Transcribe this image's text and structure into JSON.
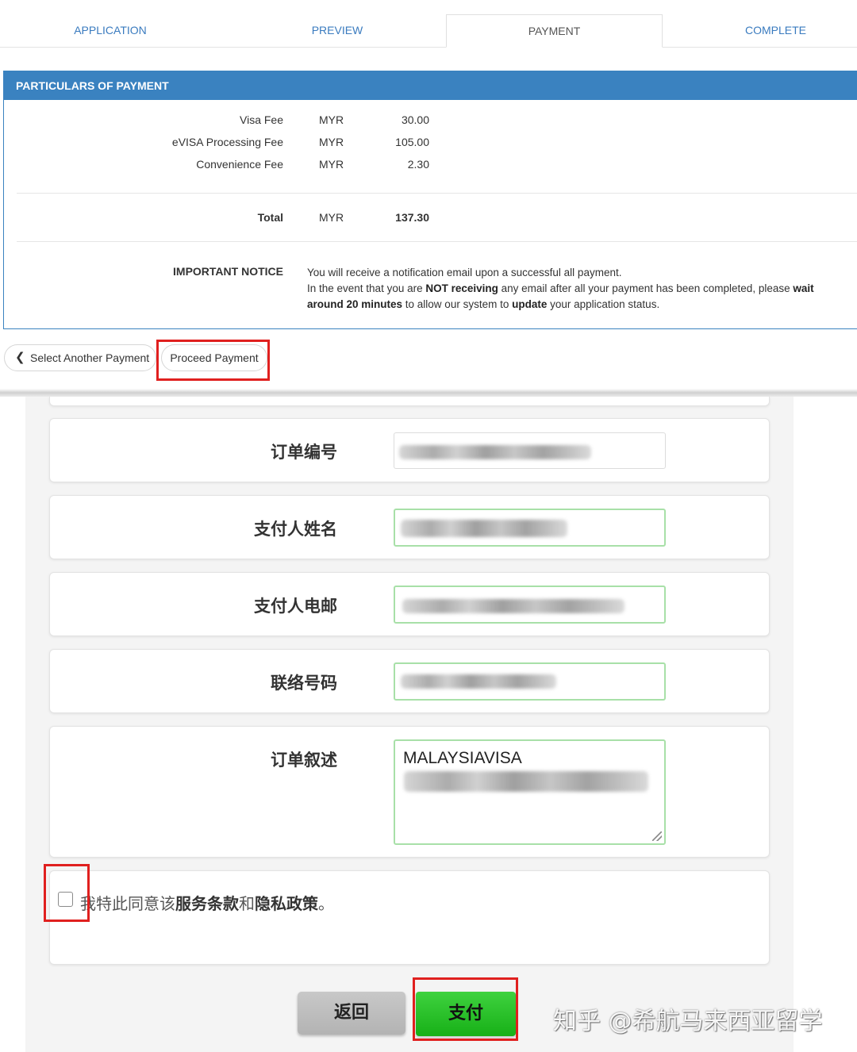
{
  "tabs": [
    {
      "label": "APPLICATION",
      "active": false
    },
    {
      "label": "PREVIEW",
      "active": false
    },
    {
      "label": "PAYMENT",
      "active": true
    },
    {
      "label": "COMPLETE",
      "active": false
    }
  ],
  "payment": {
    "header": "PARTICULARS OF PAYMENT",
    "fees": [
      {
        "label": "Visa Fee",
        "currency": "MYR",
        "amount": "30.00"
      },
      {
        "label": "eVISA Processing Fee",
        "currency": "MYR",
        "amount": "105.00"
      },
      {
        "label": "Convenience Fee",
        "currency": "MYR",
        "amount": "2.30"
      }
    ],
    "total": {
      "label": "Total",
      "currency": "MYR",
      "amount": "137.30"
    },
    "notice": {
      "label": "IMPORTANT NOTICE",
      "line1": "You will receive a notification email upon a successful all payment.",
      "line2_a": "In the event that you are ",
      "line2_b": "NOT receiving",
      "line2_c": " any email after all your payment has been completed, please ",
      "line2_d": "wait",
      "line3_a": "around 20 minutes",
      "line3_b": " to allow our system to ",
      "line3_c": "update",
      "line3_d": " your application status."
    }
  },
  "actions": {
    "back_label": "Select Another Payment",
    "proceed_label": "Proceed Payment"
  },
  "form": {
    "order_no_label": "订单编号",
    "payer_name_label": "支付人姓名",
    "payer_email_label": "支付人电邮",
    "phone_label": "联络号码",
    "order_desc_label": "订单叙述",
    "order_desc_value": "MALAYSIAVISA",
    "agree_a": "我特此同意该",
    "agree_b": "服务条款",
    "agree_c": "和",
    "agree_d": "隐私政策",
    "agree_e": "。",
    "agree_checked": false,
    "return_label": "返回",
    "pay_label": "支付"
  },
  "watermark": "知乎 @希航马来西亚留学",
  "colors": {
    "accent_blue": "#3a82c0",
    "highlight_red": "#e0201f",
    "pay_green": "#22c022",
    "input_green_border": "#a8e0a8"
  }
}
